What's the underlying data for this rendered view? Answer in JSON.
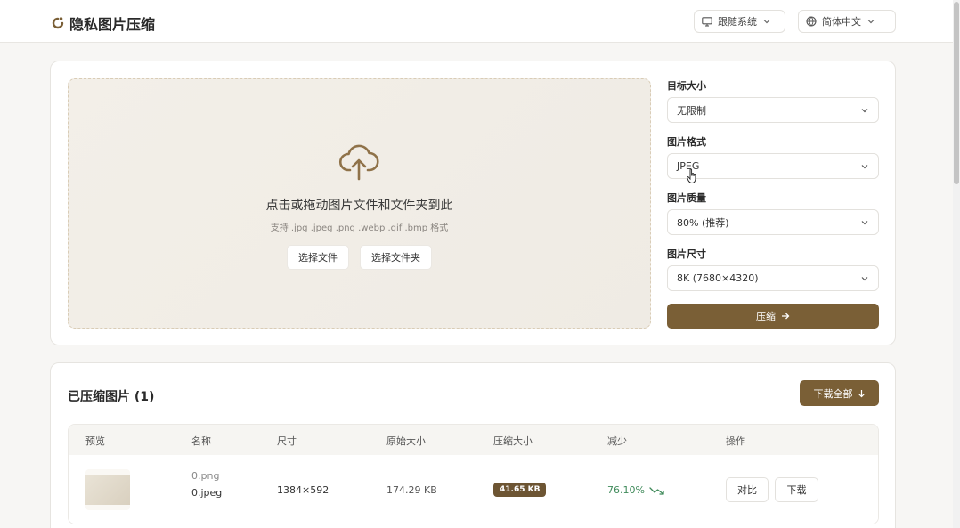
{
  "app": {
    "title": "隐私图片压缩"
  },
  "header": {
    "theme_select": "跟随系统",
    "language_select": "简体中文"
  },
  "upload": {
    "title": "点击或拖动图片文件和文件夹到此",
    "subtitle": "支持 .jpg .jpeg .png .webp .gif .bmp 格式",
    "select_files": "选择文件",
    "select_folder": "选择文件夹"
  },
  "settings": {
    "target_size_label": "目标大小",
    "target_size_value": "无限制",
    "format_label": "图片格式",
    "format_value": "JPEG",
    "quality_label": "图片质量",
    "quality_value": "80% (推荐)",
    "dimension_label": "图片尺寸",
    "dimension_value": "8K (7680×4320)",
    "compress_button": "压缩"
  },
  "results": {
    "title": "已压缩图片 (1)",
    "download_all": "下载全部",
    "columns": [
      "预览",
      "名称",
      "尺寸",
      "原始大小",
      "压缩大小",
      "减少",
      "操作"
    ],
    "rows": [
      {
        "original_name": "0.png",
        "new_name": "0.jpeg",
        "dimensions": "1384×592",
        "original_size": "174.29 KB",
        "compressed_size": "41.65 KB",
        "reduction": "76.10%",
        "compare_button": "对比",
        "download_button": "下载"
      }
    ]
  },
  "colors": {
    "accent": "#7a5f36",
    "badge": "#6d5533",
    "reduction": "#3f8a5a"
  }
}
